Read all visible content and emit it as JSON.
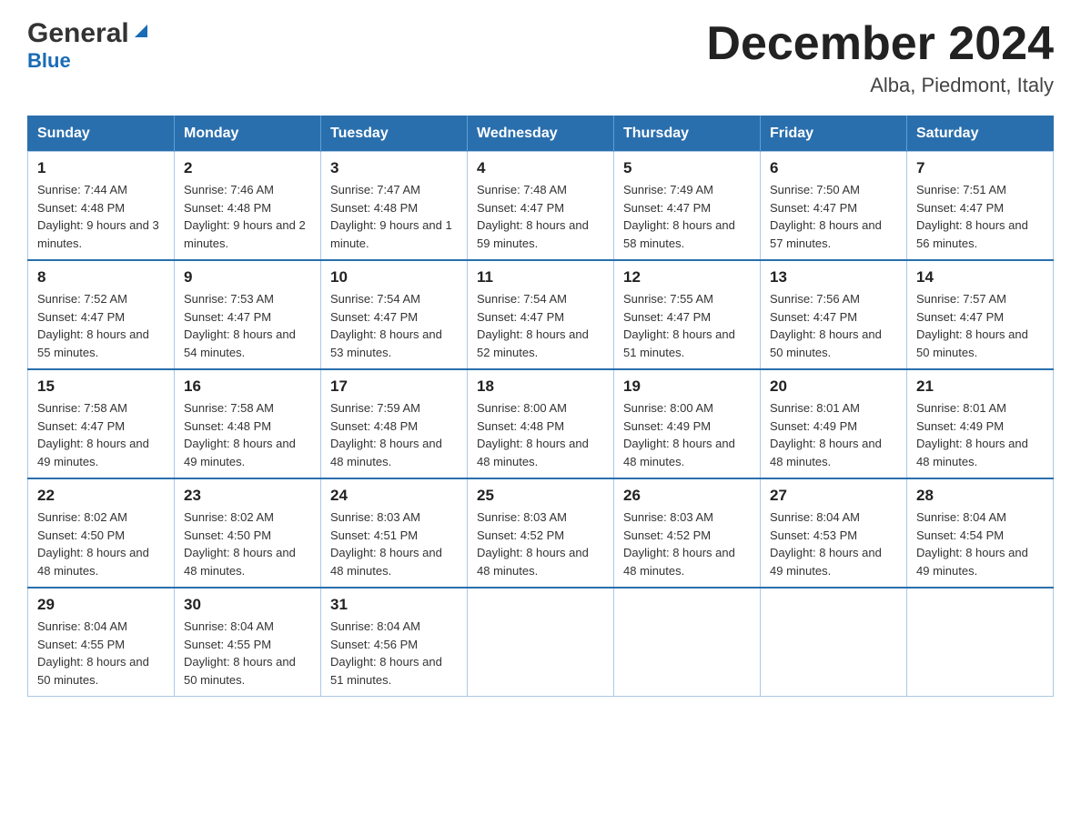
{
  "header": {
    "logo_general": "General",
    "logo_blue": "Blue",
    "month_title": "December 2024",
    "location": "Alba, Piedmont, Italy"
  },
  "days_header": [
    "Sunday",
    "Monday",
    "Tuesday",
    "Wednesday",
    "Thursday",
    "Friday",
    "Saturday"
  ],
  "weeks": [
    [
      {
        "day": "1",
        "sunrise": "Sunrise: 7:44 AM",
        "sunset": "Sunset: 4:48 PM",
        "daylight": "Daylight: 9 hours and 3 minutes."
      },
      {
        "day": "2",
        "sunrise": "Sunrise: 7:46 AM",
        "sunset": "Sunset: 4:48 PM",
        "daylight": "Daylight: 9 hours and 2 minutes."
      },
      {
        "day": "3",
        "sunrise": "Sunrise: 7:47 AM",
        "sunset": "Sunset: 4:48 PM",
        "daylight": "Daylight: 9 hours and 1 minute."
      },
      {
        "day": "4",
        "sunrise": "Sunrise: 7:48 AM",
        "sunset": "Sunset: 4:47 PM",
        "daylight": "Daylight: 8 hours and 59 minutes."
      },
      {
        "day": "5",
        "sunrise": "Sunrise: 7:49 AM",
        "sunset": "Sunset: 4:47 PM",
        "daylight": "Daylight: 8 hours and 58 minutes."
      },
      {
        "day": "6",
        "sunrise": "Sunrise: 7:50 AM",
        "sunset": "Sunset: 4:47 PM",
        "daylight": "Daylight: 8 hours and 57 minutes."
      },
      {
        "day": "7",
        "sunrise": "Sunrise: 7:51 AM",
        "sunset": "Sunset: 4:47 PM",
        "daylight": "Daylight: 8 hours and 56 minutes."
      }
    ],
    [
      {
        "day": "8",
        "sunrise": "Sunrise: 7:52 AM",
        "sunset": "Sunset: 4:47 PM",
        "daylight": "Daylight: 8 hours and 55 minutes."
      },
      {
        "day": "9",
        "sunrise": "Sunrise: 7:53 AM",
        "sunset": "Sunset: 4:47 PM",
        "daylight": "Daylight: 8 hours and 54 minutes."
      },
      {
        "day": "10",
        "sunrise": "Sunrise: 7:54 AM",
        "sunset": "Sunset: 4:47 PM",
        "daylight": "Daylight: 8 hours and 53 minutes."
      },
      {
        "day": "11",
        "sunrise": "Sunrise: 7:54 AM",
        "sunset": "Sunset: 4:47 PM",
        "daylight": "Daylight: 8 hours and 52 minutes."
      },
      {
        "day": "12",
        "sunrise": "Sunrise: 7:55 AM",
        "sunset": "Sunset: 4:47 PM",
        "daylight": "Daylight: 8 hours and 51 minutes."
      },
      {
        "day": "13",
        "sunrise": "Sunrise: 7:56 AM",
        "sunset": "Sunset: 4:47 PM",
        "daylight": "Daylight: 8 hours and 50 minutes."
      },
      {
        "day": "14",
        "sunrise": "Sunrise: 7:57 AM",
        "sunset": "Sunset: 4:47 PM",
        "daylight": "Daylight: 8 hours and 50 minutes."
      }
    ],
    [
      {
        "day": "15",
        "sunrise": "Sunrise: 7:58 AM",
        "sunset": "Sunset: 4:47 PM",
        "daylight": "Daylight: 8 hours and 49 minutes."
      },
      {
        "day": "16",
        "sunrise": "Sunrise: 7:58 AM",
        "sunset": "Sunset: 4:48 PM",
        "daylight": "Daylight: 8 hours and 49 minutes."
      },
      {
        "day": "17",
        "sunrise": "Sunrise: 7:59 AM",
        "sunset": "Sunset: 4:48 PM",
        "daylight": "Daylight: 8 hours and 48 minutes."
      },
      {
        "day": "18",
        "sunrise": "Sunrise: 8:00 AM",
        "sunset": "Sunset: 4:48 PM",
        "daylight": "Daylight: 8 hours and 48 minutes."
      },
      {
        "day": "19",
        "sunrise": "Sunrise: 8:00 AM",
        "sunset": "Sunset: 4:49 PM",
        "daylight": "Daylight: 8 hours and 48 minutes."
      },
      {
        "day": "20",
        "sunrise": "Sunrise: 8:01 AM",
        "sunset": "Sunset: 4:49 PM",
        "daylight": "Daylight: 8 hours and 48 minutes."
      },
      {
        "day": "21",
        "sunrise": "Sunrise: 8:01 AM",
        "sunset": "Sunset: 4:49 PM",
        "daylight": "Daylight: 8 hours and 48 minutes."
      }
    ],
    [
      {
        "day": "22",
        "sunrise": "Sunrise: 8:02 AM",
        "sunset": "Sunset: 4:50 PM",
        "daylight": "Daylight: 8 hours and 48 minutes."
      },
      {
        "day": "23",
        "sunrise": "Sunrise: 8:02 AM",
        "sunset": "Sunset: 4:50 PM",
        "daylight": "Daylight: 8 hours and 48 minutes."
      },
      {
        "day": "24",
        "sunrise": "Sunrise: 8:03 AM",
        "sunset": "Sunset: 4:51 PM",
        "daylight": "Daylight: 8 hours and 48 minutes."
      },
      {
        "day": "25",
        "sunrise": "Sunrise: 8:03 AM",
        "sunset": "Sunset: 4:52 PM",
        "daylight": "Daylight: 8 hours and 48 minutes."
      },
      {
        "day": "26",
        "sunrise": "Sunrise: 8:03 AM",
        "sunset": "Sunset: 4:52 PM",
        "daylight": "Daylight: 8 hours and 48 minutes."
      },
      {
        "day": "27",
        "sunrise": "Sunrise: 8:04 AM",
        "sunset": "Sunset: 4:53 PM",
        "daylight": "Daylight: 8 hours and 49 minutes."
      },
      {
        "day": "28",
        "sunrise": "Sunrise: 8:04 AM",
        "sunset": "Sunset: 4:54 PM",
        "daylight": "Daylight: 8 hours and 49 minutes."
      }
    ],
    [
      {
        "day": "29",
        "sunrise": "Sunrise: 8:04 AM",
        "sunset": "Sunset: 4:55 PM",
        "daylight": "Daylight: 8 hours and 50 minutes."
      },
      {
        "day": "30",
        "sunrise": "Sunrise: 8:04 AM",
        "sunset": "Sunset: 4:55 PM",
        "daylight": "Daylight: 8 hours and 50 minutes."
      },
      {
        "day": "31",
        "sunrise": "Sunrise: 8:04 AM",
        "sunset": "Sunset: 4:56 PM",
        "daylight": "Daylight: 8 hours and 51 minutes."
      },
      null,
      null,
      null,
      null
    ]
  ]
}
